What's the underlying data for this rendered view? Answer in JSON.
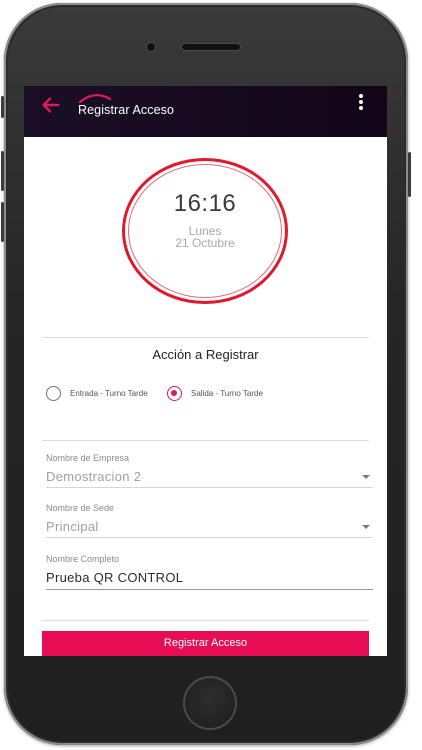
{
  "appbar": {
    "title": "Registrar Acceso",
    "back_icon": "arrow-left-icon",
    "menu_icon": "more-vertical-icon",
    "accent_color": "#e0185c"
  },
  "clock": {
    "time": "16:16",
    "day": "Lunes",
    "date": "21 Octubre",
    "ring_color": "#e0182d"
  },
  "action": {
    "title": "Acción a Registrar",
    "options": [
      {
        "label": "Entrada - Turno Tarde",
        "checked": false
      },
      {
        "label": "Salida - Turno Tarde",
        "checked": true
      }
    ]
  },
  "form": {
    "empresa": {
      "label": "Nombre de Empresa",
      "value": "Demostracion 2"
    },
    "sede": {
      "label": "Nombre de Sede",
      "value": "Principal"
    },
    "nombre": {
      "label": "Nombre Completo",
      "value": "Prueba QR CONTROL"
    }
  },
  "submit": {
    "label": "Registrar Acceso",
    "color": "#e60d54"
  }
}
